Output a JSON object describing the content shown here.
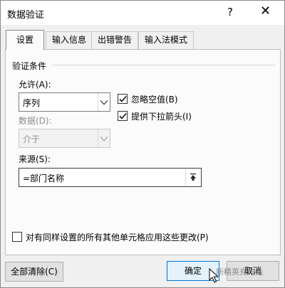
{
  "window": {
    "title": "数据验证",
    "help": "?",
    "close": "✕"
  },
  "tabs": [
    {
      "label": "设置",
      "active": true
    },
    {
      "label": "输入信息"
    },
    {
      "label": "出错警告"
    },
    {
      "label": "输入法模式"
    }
  ],
  "settings": {
    "section_title": "验证条件",
    "allow_label": "允许(A):",
    "allow_value": "序列",
    "ignore_blank_label": "忽略空值(B)",
    "ignore_blank_checked": true,
    "dropdown_label": "提供下拉箭头(I)",
    "dropdown_checked": true,
    "data_label": "数据(D):",
    "data_value": "介于",
    "source_label": "来源(S):",
    "source_value": "=部门名称",
    "apply_all_label": "对有同样设置的所有其他单元格应用这些更改(P)",
    "apply_all_checked": false
  },
  "buttons": {
    "clear_all": "全部清除(C)",
    "ok": "确定",
    "cancel": "取消"
  },
  "watermark": "新精英充电站",
  "colors": {
    "accent": "#0078d7"
  }
}
